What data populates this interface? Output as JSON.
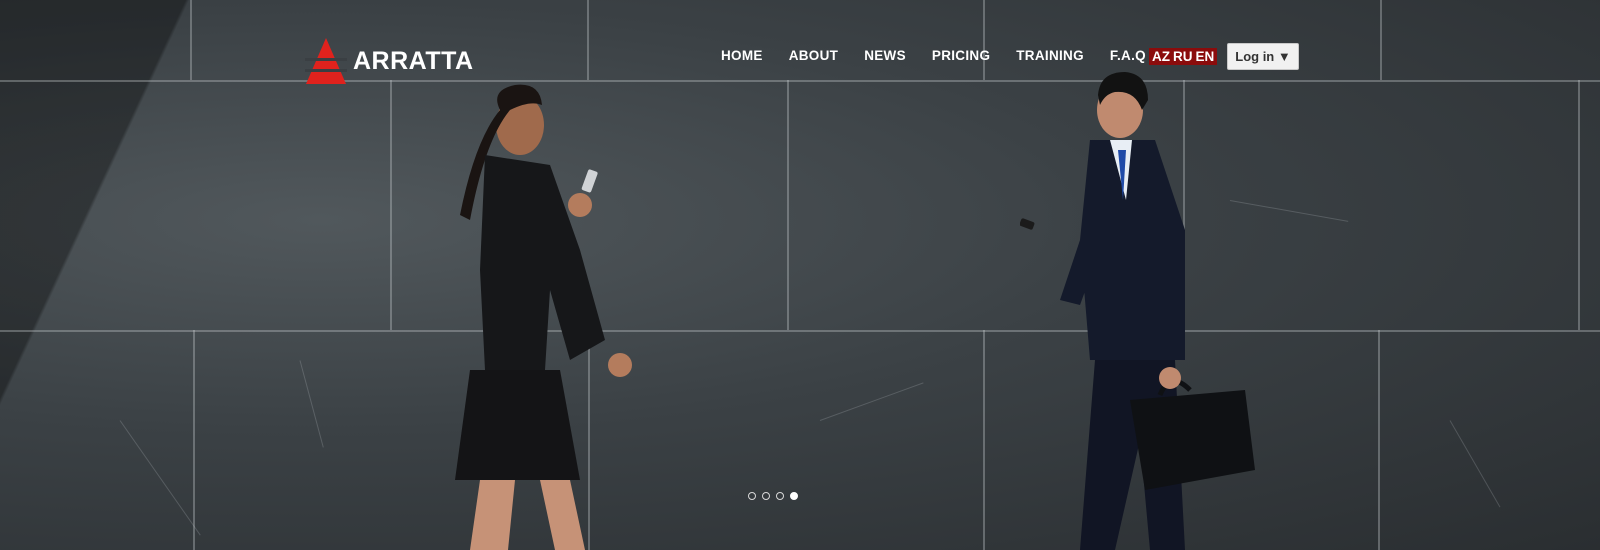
{
  "brand": {
    "name": "ARRATTA",
    "logo_color": "#e0221d"
  },
  "nav": {
    "items": [
      {
        "label": "HOME"
      },
      {
        "label": "ABOUT"
      },
      {
        "label": "NEWS"
      },
      {
        "label": "PRICING"
      },
      {
        "label": "TRAINING"
      },
      {
        "label": "F.A.Q"
      }
    ]
  },
  "languages": {
    "items": [
      "AZ",
      "RU",
      "EN"
    ],
    "accent": "#8b0c0c"
  },
  "login": {
    "label": "Log in ▼"
  },
  "slider": {
    "slide_count": 4,
    "active_index": 3
  }
}
